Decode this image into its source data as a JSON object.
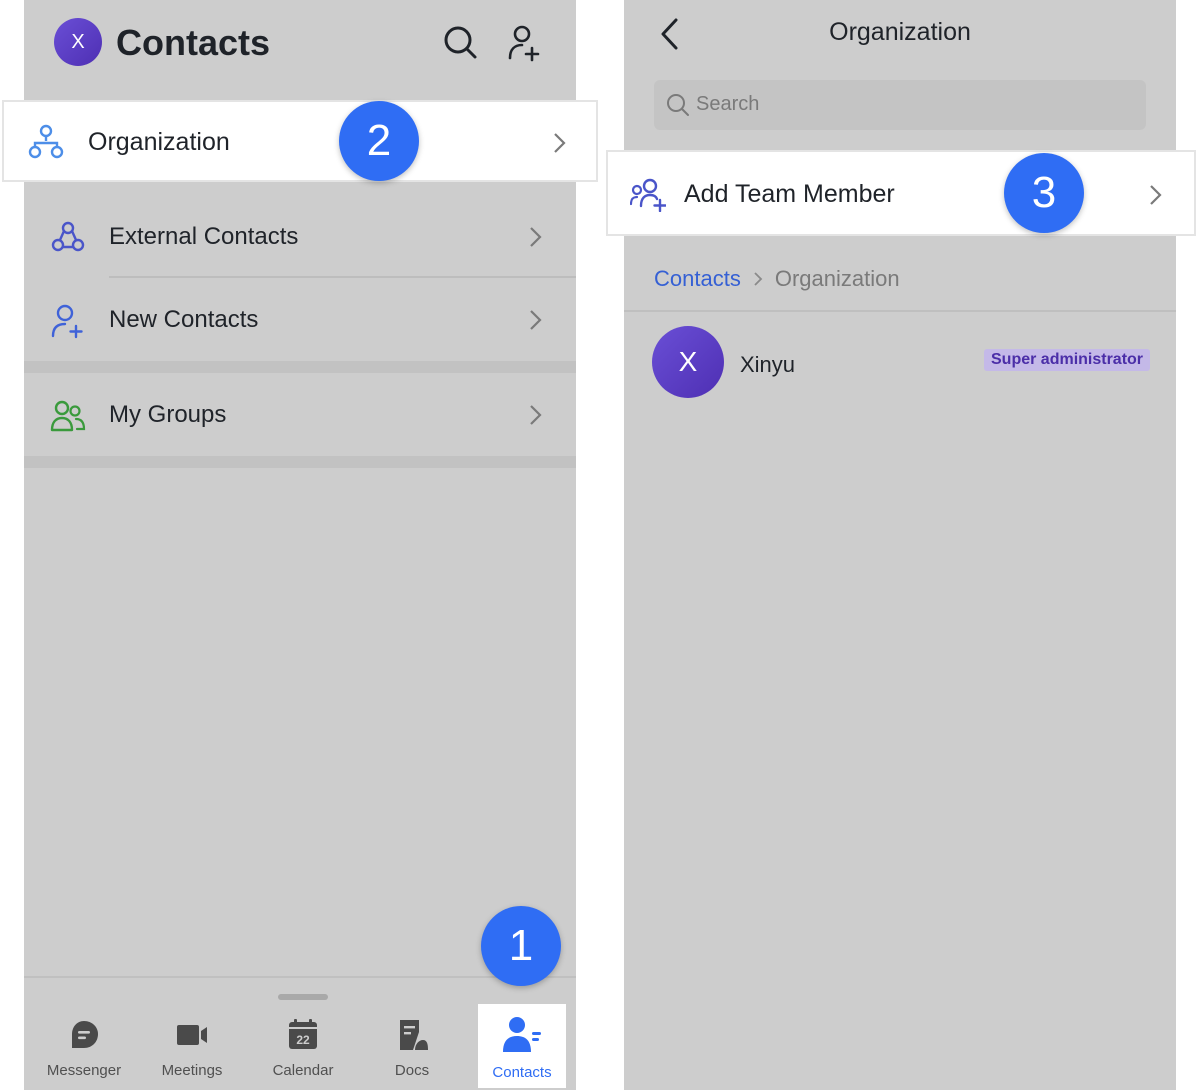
{
  "left": {
    "header": {
      "avatar_letter": "X",
      "title": "Contacts",
      "search_icon": "search-icon",
      "add_icon": "add-contact-icon"
    },
    "rows": [
      {
        "label": "Organization",
        "icon": "organization-icon"
      },
      {
        "label": "External Contacts",
        "icon": "external-contacts-icon"
      },
      {
        "label": "New Contacts",
        "icon": "new-contacts-icon"
      },
      {
        "label": "My Groups",
        "icon": "groups-icon"
      }
    ],
    "tabs": [
      {
        "label": "Messenger",
        "icon": "messenger-icon"
      },
      {
        "label": "Meetings",
        "icon": "meetings-icon"
      },
      {
        "label": "Calendar",
        "icon": "calendar-icon",
        "calendar_day": "22"
      },
      {
        "label": "Docs",
        "icon": "docs-icon"
      },
      {
        "label": "Contacts",
        "icon": "contacts-icon"
      }
    ]
  },
  "right": {
    "header": {
      "title": "Organization"
    },
    "search": {
      "placeholder": "Search"
    },
    "add_member": {
      "label": "Add Team Member",
      "icon": "add-team-member-icon"
    },
    "breadcrumb": {
      "root": "Contacts",
      "current": "Organization"
    },
    "members": [
      {
        "avatar_letter": "X",
        "name": "Xinyu",
        "role": "Super administrator"
      }
    ]
  },
  "steps": [
    "1",
    "2",
    "3"
  ],
  "colors": {
    "accent": "#2f6df4",
    "link": "#3560d4",
    "avatar": "#5b3cc4",
    "background": "#cdcdcd",
    "role_badge": "#c4b9e8"
  }
}
